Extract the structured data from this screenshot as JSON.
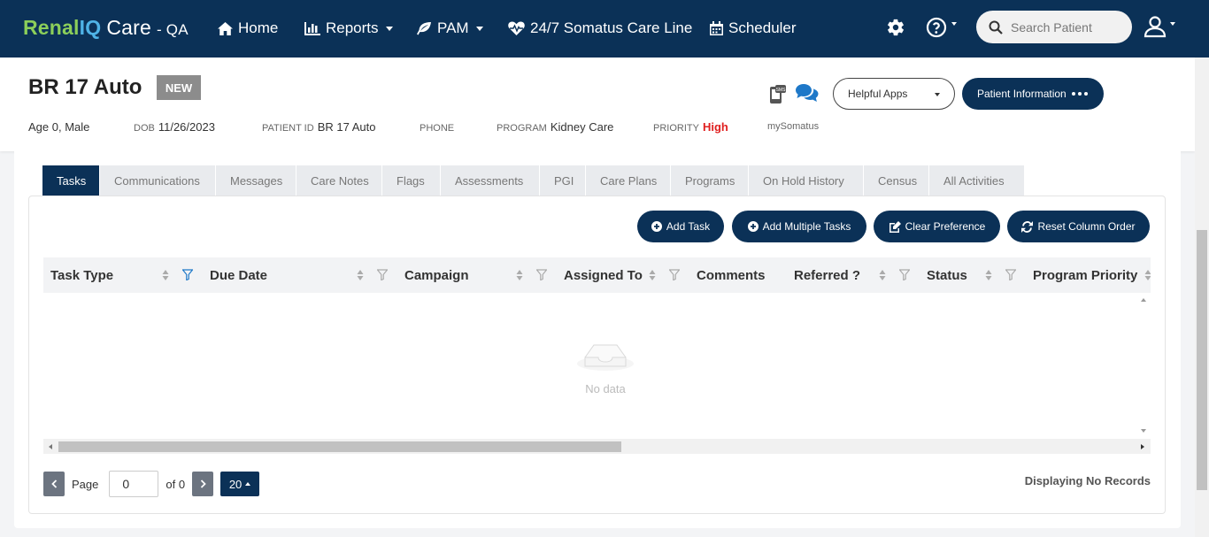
{
  "app": {
    "brand_renal": "Renal",
    "brand_iq": "IQ",
    "brand_care": "Care",
    "brand_env": "- QA"
  },
  "nav": {
    "home": "Home",
    "reports": "Reports",
    "pam": "PAM",
    "careline": "24/7 Somatus Care Line",
    "scheduler": "Scheduler"
  },
  "search": {
    "placeholder": "Search Patient",
    "value": ""
  },
  "patient": {
    "name": "BR 17 Auto",
    "badge": "NEW",
    "age_sex": "Age 0, Male",
    "dob_label": "DOB",
    "dob": "11/26/2023",
    "pid_label": "PATIENT ID",
    "pid": "BR 17 Auto",
    "phone_label": "PHONE",
    "phone": "",
    "program_label": "PROGRAM",
    "program": "Kidney Care",
    "priority_label": "PRIORITY",
    "priority": "High",
    "mysomatus": "mySomatus"
  },
  "actions": {
    "helpful_apps": "Helpful Apps",
    "patient_info": "Patient Information"
  },
  "tabs": [
    "Tasks",
    "Communications",
    "Messages",
    "Care Notes",
    "Flags",
    "Assessments",
    "PGI",
    "Care Plans",
    "Programs",
    "On Hold History",
    "Census",
    "All Activities"
  ],
  "active_tab": "Tasks",
  "toolbar": {
    "add_task": "Add Task",
    "add_multiple": "Add Multiple Tasks",
    "clear_pref": "Clear Preference",
    "reset_cols": "Reset Column Order"
  },
  "table": {
    "columns": [
      "Task Type",
      "Due Date",
      "Campaign",
      "Assigned To",
      "Comments",
      "Referred ?",
      "Status",
      "Program Priority"
    ],
    "empty_text": "No data"
  },
  "pagination": {
    "page_label": "Page",
    "page_value": "0",
    "of_label": "of 0",
    "page_size": "20",
    "status": "Displaying No Records"
  },
  "colors": {
    "navy": "#0b3157",
    "priority_high": "#e02020",
    "brand_green": "#8ccf5a",
    "brand_blue": "#4fb3e6"
  }
}
